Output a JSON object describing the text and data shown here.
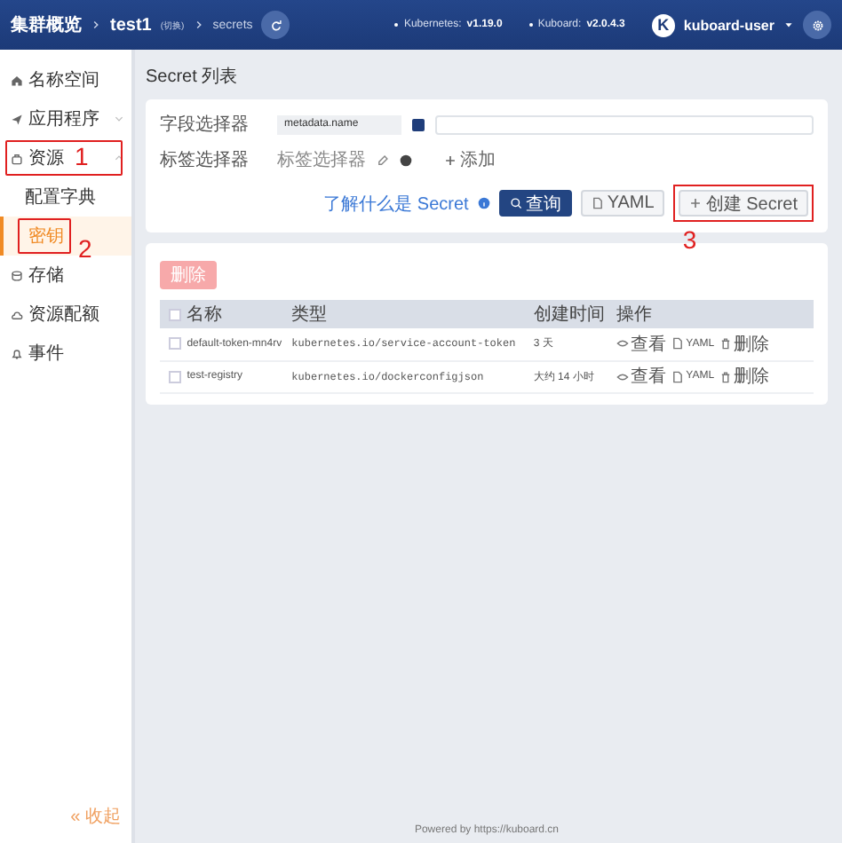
{
  "header": {
    "breadcrumb": [
      {
        "label": "集群概览",
        "kind": "link"
      },
      {
        "label": "test1",
        "kind": "link",
        "extra": "(切换)"
      },
      {
        "label": "secrets",
        "kind": "current"
      }
    ],
    "versions": [
      {
        "name": "Kubernetes:",
        "value": "v1.19.0"
      },
      {
        "name": "Kuboard:",
        "value": "v2.0.4.3"
      }
    ],
    "avatar": "K",
    "user": "kuboard-user"
  },
  "sidebar": {
    "items": [
      {
        "label": "名称空间"
      },
      {
        "label": "应用程序",
        "expanded": false
      },
      {
        "label": "资源",
        "expanded": true,
        "callout": "1",
        "children": [
          {
            "label": "配置字典",
            "selected": false
          },
          {
            "label": "密钥",
            "selected": true,
            "callout": "2"
          }
        ]
      },
      {
        "label": "存储"
      },
      {
        "label": "资源配额"
      },
      {
        "label": "事件"
      }
    ],
    "collapse": "« 收起"
  },
  "page_title": "Secret 列表",
  "filters": {
    "field_label": "字段选择器",
    "field_value": "metadata.name",
    "label_label": "标签选择器",
    "label_hint": "标签选择器",
    "add": "添加"
  },
  "actions": {
    "help_link": "了解什么是 Secret",
    "query": "查询",
    "yaml": "YAML",
    "create": "创建 Secret",
    "create_callout": "3"
  },
  "delete_button": {
    "label": "删除",
    "disabled": true
  },
  "table": {
    "all_checked": false,
    "columns": [
      "名称",
      "类型",
      "创建时间",
      "操作"
    ],
    "rows": [
      {
        "name": "default-token-mn4rv",
        "type": "kubernetes.io/service-account-token",
        "created": "3 天",
        "checked": false,
        "actions": [
          "查看",
          "YAML",
          "删除"
        ]
      },
      {
        "name": "test-registry",
        "type": "kubernetes.io/dockerconfigjson",
        "created": "大约 14 小时",
        "checked": false,
        "actions": [
          "查看",
          "YAML",
          "删除"
        ]
      }
    ]
  },
  "footer": "Powered by https://kuboard.cn"
}
